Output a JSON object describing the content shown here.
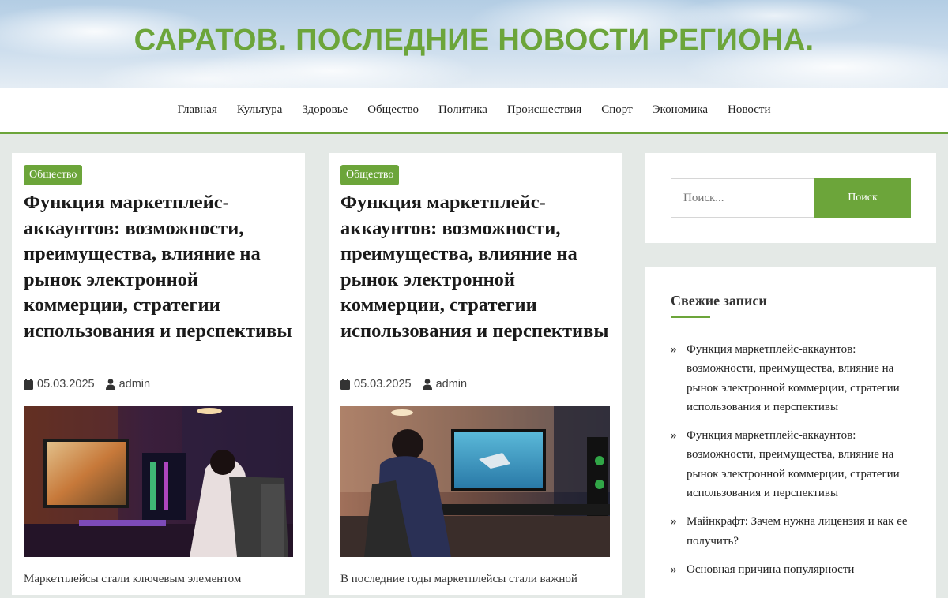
{
  "header": {
    "site_title": "САРАТОВ. ПОСЛЕДНИЕ НОВОСТИ РЕГИОНА."
  },
  "nav": {
    "items": [
      "Главная",
      "Культура",
      "Здоровье",
      "Общество",
      "Политика",
      "Происшествия",
      "Спорт",
      "Экономика",
      "Новости"
    ]
  },
  "posts": [
    {
      "category": "Общество",
      "title": "Функция маркетплейс-аккаунтов: возможности, преимущества, влияние на рынок электронной коммерции, стратегии использования и перспективы",
      "date": "05.03.2025",
      "author": "admin",
      "excerpt": "Маркетплейсы стали ключевым элементом"
    },
    {
      "category": "Общество",
      "title": "Функция маркетплейс-аккаунтов: возможности, преимущества, влияние на рынок электронной коммерции, стратегии использования и перспективы",
      "date": "05.03.2025",
      "author": "admin",
      "excerpt": "В последние годы маркетплейсы стали важной"
    }
  ],
  "sidebar": {
    "search": {
      "placeholder": "Поиск...",
      "button": "Поиск"
    },
    "recent": {
      "title": "Свежие записи",
      "items": [
        "Функция маркетплейс-аккаунтов: возможности, преимущества, влияние на рынок электронной коммерции, стратегии использования и перспективы",
        "Функция маркетплейс-аккаунтов: возможности, преимущества, влияние на рынок электронной коммерции, стратегии использования и перспективы",
        "Майнкрафт: Зачем нужна лицензия и как ее получить?",
        "Основная причина популярности"
      ]
    }
  },
  "colors": {
    "accent": "#6ca53a",
    "background": "#e4e9e6"
  }
}
